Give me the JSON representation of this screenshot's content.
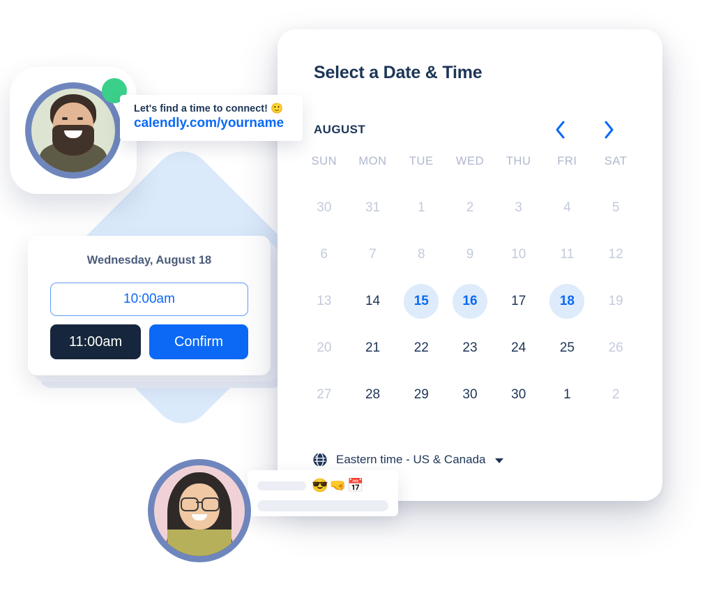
{
  "calendar": {
    "title": "Select a Date & Time",
    "month": "AUGUST",
    "prev_icon": "chevron-left-icon",
    "next_icon": "chevron-right-icon",
    "weekdays": [
      "SUN",
      "MON",
      "TUE",
      "WED",
      "THU",
      "FRI",
      "SAT"
    ],
    "days": [
      {
        "label": "30",
        "state": "muted"
      },
      {
        "label": "31",
        "state": "muted"
      },
      {
        "label": "1",
        "state": "muted"
      },
      {
        "label": "2",
        "state": "muted"
      },
      {
        "label": "3",
        "state": "muted"
      },
      {
        "label": "4",
        "state": "muted"
      },
      {
        "label": "5",
        "state": "muted"
      },
      {
        "label": "6",
        "state": "muted"
      },
      {
        "label": "7",
        "state": "muted"
      },
      {
        "label": "8",
        "state": "muted"
      },
      {
        "label": "9",
        "state": "muted"
      },
      {
        "label": "10",
        "state": "muted"
      },
      {
        "label": "11",
        "state": "muted"
      },
      {
        "label": "12",
        "state": "muted"
      },
      {
        "label": "13",
        "state": "muted"
      },
      {
        "label": "14",
        "state": "normal"
      },
      {
        "label": "15",
        "state": "available"
      },
      {
        "label": "16",
        "state": "available"
      },
      {
        "label": "17",
        "state": "normal"
      },
      {
        "label": "18",
        "state": "available"
      },
      {
        "label": "19",
        "state": "muted"
      },
      {
        "label": "20",
        "state": "muted"
      },
      {
        "label": "21",
        "state": "normal"
      },
      {
        "label": "22",
        "state": "normal"
      },
      {
        "label": "23",
        "state": "normal"
      },
      {
        "label": "24",
        "state": "normal"
      },
      {
        "label": "25",
        "state": "normal"
      },
      {
        "label": "26",
        "state": "muted"
      },
      {
        "label": "27",
        "state": "muted"
      },
      {
        "label": "28",
        "state": "normal"
      },
      {
        "label": "29",
        "state": "normal"
      },
      {
        "label": "30",
        "state": "normal"
      },
      {
        "label": "30",
        "state": "normal"
      },
      {
        "label": "1",
        "state": "normal"
      },
      {
        "label": "2",
        "state": "muted"
      }
    ],
    "timezone": {
      "icon": "globe-icon",
      "label": "Eastern time - US & Canada",
      "caret": "chevron-down-icon"
    }
  },
  "link_card": {
    "message": "Let's find a time to connect! 🙂",
    "url": "calendly.com/yourname"
  },
  "avatar_top": {
    "name": "avatar-man",
    "status": "online"
  },
  "avatar_bottom": {
    "name": "avatar-woman"
  },
  "slot_card": {
    "date": "Wednesday, August 18",
    "selected_time": "10:00am",
    "other_time": "11:00am",
    "confirm_label": "Confirm"
  },
  "emoji_card": {
    "emojis": "😎🤜📅"
  },
  "colors": {
    "accent_blue": "#0b69f5",
    "available_bg": "#ddebfb",
    "dark_navy": "#16263c",
    "title_navy": "#1d3557",
    "muted_day": "#c3cadc",
    "diamond_blue": "#dbeafb",
    "status_green": "#3bd08a"
  }
}
